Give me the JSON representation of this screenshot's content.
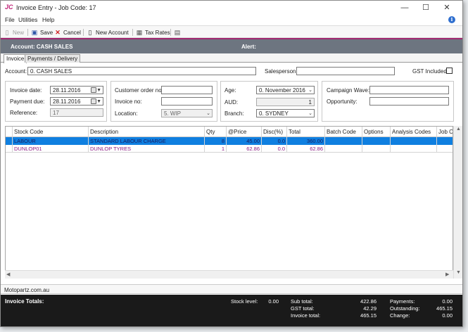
{
  "window": {
    "logo": "JC",
    "title": "Invoice Entry - Job Code: 17",
    "controls": {
      "minimize": "—",
      "maximize": "☐",
      "close": "✕"
    }
  },
  "menu": [
    "File",
    "Utilities",
    "Help"
  ],
  "toolbar": {
    "new": "New",
    "save": "Save",
    "cancel": "Cancel",
    "new_account": "New Account",
    "tax_rates": "Tax Rates"
  },
  "account_bar": {
    "account": "Account: CASH SALES",
    "alert": "Alert:"
  },
  "tabs": [
    "Invoice",
    "Payments / Delivery"
  ],
  "account_row": {
    "account_label": "Account:",
    "account_value": "0. CASH SALES",
    "salesperson_label": "Salesperson:",
    "salesperson_value": "",
    "gst_label": "GST Included:"
  },
  "panel1": {
    "invoice_date_label": "Invoice date:",
    "invoice_date_value": "28.11.2016",
    "payment_due_label": "Payment due:",
    "payment_due_value": "28.11.2016",
    "reference_label": "Reference:",
    "reference_value": "17"
  },
  "panel2": {
    "customer_order_label": "Customer order no:",
    "customer_order_value": "",
    "invoice_no_label": "Invoice no:",
    "invoice_no_value": "",
    "location_label": "Location:",
    "location_value": "5. WIP"
  },
  "panel3": {
    "age_label": "Age:",
    "age_value": "0. November 2016",
    "aud_label": "AUD:",
    "aud_value": "1",
    "branch_label": "Branch:",
    "branch_value": "0. SYDNEY"
  },
  "panel4": {
    "campaign_label": "Campaign Wave:",
    "campaign_value": "",
    "opportunity_label": "Opportunity:",
    "opportunity_value": ""
  },
  "grid": {
    "columns": [
      "Stock Code",
      "Description",
      "Qty",
      "@Price",
      "Disc(%)",
      "Total",
      "Batch Code",
      "Options",
      "Analysis Codes",
      "Job Co"
    ],
    "rows": [
      [
        "LABOUR",
        "STANDARD LABOUR CHARGE",
        "8",
        "45.00",
        "0.0",
        "360.00",
        "",
        "",
        "",
        ""
      ],
      [
        "DUNLOP01",
        "DUNLOP TYRES",
        "1",
        "62.86",
        "0.0",
        "62.86",
        "",
        "",
        "",
        ""
      ]
    ]
  },
  "status_text": "Motopartz.com.au",
  "totals": {
    "heading": "Invoice Totals:",
    "stock_level_label": "Stock level:",
    "stock_level_value": "0.00",
    "sub_total_label": "Sub total:",
    "sub_total_value": "422.86",
    "gst_total_label": "GST total:",
    "gst_total_value": "42.29",
    "invoice_total_label": "Invoice total:",
    "invoice_total_value": "465.15",
    "payments_label": "Payments:",
    "payments_value": "0.00",
    "outstanding_label": "Outstanding:",
    "outstanding_value": "465.15",
    "change_label": "Change:",
    "change_value": "0.00"
  },
  "colors": {
    "accent": "#a0266f",
    "account_bar": "#6d7580",
    "selection": "#0f7fe0"
  }
}
